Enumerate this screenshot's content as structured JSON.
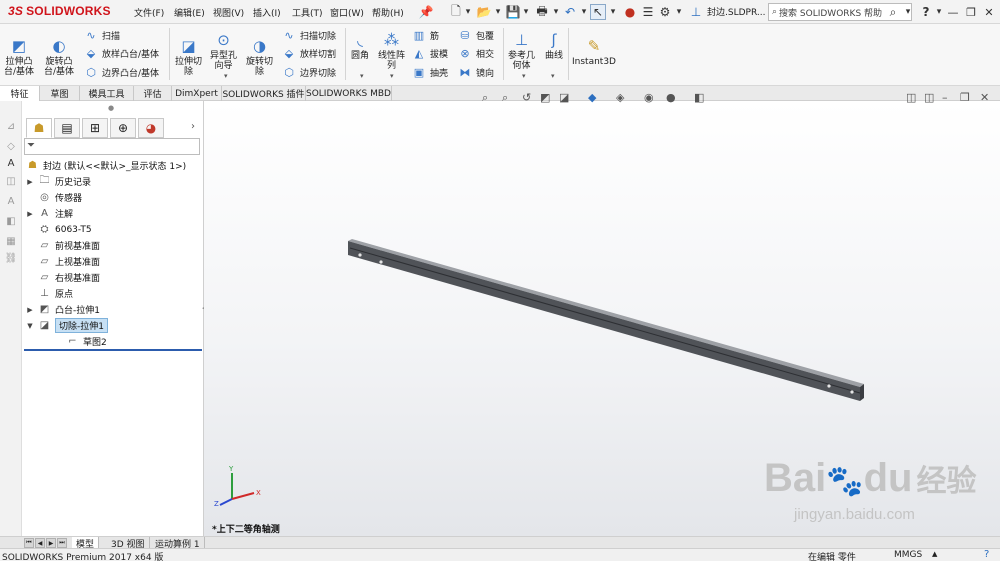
{
  "app": {
    "logo_prefix": "3S",
    "logo_text": "SOLIDWORKS",
    "document_name": "封边.SLDPR...",
    "search_placeholder": "搜索 SOLIDWORKS 帮助",
    "help_label": "?"
  },
  "menu": [
    "文件(F)",
    "编辑(E)",
    "视图(V)",
    "插入(I)",
    "工具(T)",
    "窗口(W)",
    "帮助(H)"
  ],
  "ribbon": {
    "extrude_boss": "拉伸凸\n台/基体",
    "revolve_boss": "旋转凸\n台/基体",
    "sweep": "扫描",
    "loft_boss": "放样凸台/基体",
    "boundary_boss": "边界凸台/基体",
    "extrude_cut": "拉伸切\n除",
    "hole_wizard": "异型孔\n向导",
    "revolve_cut": "旋转切\n除",
    "swept_cut": "扫描切除",
    "lofted_cut": "放样切割",
    "boundary_cut": "边界切除",
    "fillet": "圆角",
    "linear_pattern": "线性阵\n列",
    "rib": "筋",
    "draft": "拔模",
    "shell": "抽壳",
    "wrap": "包覆",
    "intersect": "相交",
    "mirror": "镜向",
    "reference_geometry": "参考几\n何体",
    "curves": "曲线",
    "instant3d": "Instant3D"
  },
  "tabs": [
    "特征",
    "草图",
    "模具工具",
    "评估",
    "DimXpert",
    "SOLIDWORKS 插件",
    "SOLIDWORKS MBD"
  ],
  "tree": {
    "part_name": "封边  (默认<<默认>_显示状态 1>)",
    "items": [
      {
        "label": "历史记录",
        "icon": "history-folder-icon",
        "expand": "▶"
      },
      {
        "label": "传感器",
        "icon": "sensor-icon",
        "expand": ""
      },
      {
        "label": "注解",
        "icon": "annotation-icon",
        "expand": "▶"
      },
      {
        "label": "6063-T5",
        "icon": "material-icon",
        "expand": ""
      },
      {
        "label": "前视基准面",
        "icon": "plane-icon",
        "expand": ""
      },
      {
        "label": "上视基准面",
        "icon": "plane-icon",
        "expand": ""
      },
      {
        "label": "右视基准面",
        "icon": "plane-icon",
        "expand": ""
      },
      {
        "label": "原点",
        "icon": "origin-icon",
        "expand": ""
      },
      {
        "label": "凸台-拉伸1",
        "icon": "boss-extrude-icon",
        "expand": "▶"
      },
      {
        "label": "切除-拉伸1",
        "icon": "cut-extrude-icon",
        "expand": "▼"
      },
      {
        "label": "草图2",
        "icon": "sketch-icon",
        "expand": ""
      }
    ]
  },
  "viewport": {
    "view_label": "*上下二等角轴测",
    "axis_labels": {
      "x": "X",
      "y": "Y",
      "z": "Z"
    }
  },
  "bottom_tabs": [
    "模型",
    "3D 视图",
    "运动算例 1"
  ],
  "status": {
    "product": "SOLIDWORKS Premium 2017 x64 版",
    "mode": "在编辑 零件",
    "units": "MMGS",
    "units_caret": "▲"
  },
  "watermark": {
    "brand": "Bai",
    "brand2": "du",
    "brand_cn": "经验",
    "url": "jingyan.baidu.com"
  },
  "colors": {
    "logo_red": "#d0141b",
    "selection_blue": "#c7e0f4",
    "tree_underline": "#2c5cad"
  }
}
